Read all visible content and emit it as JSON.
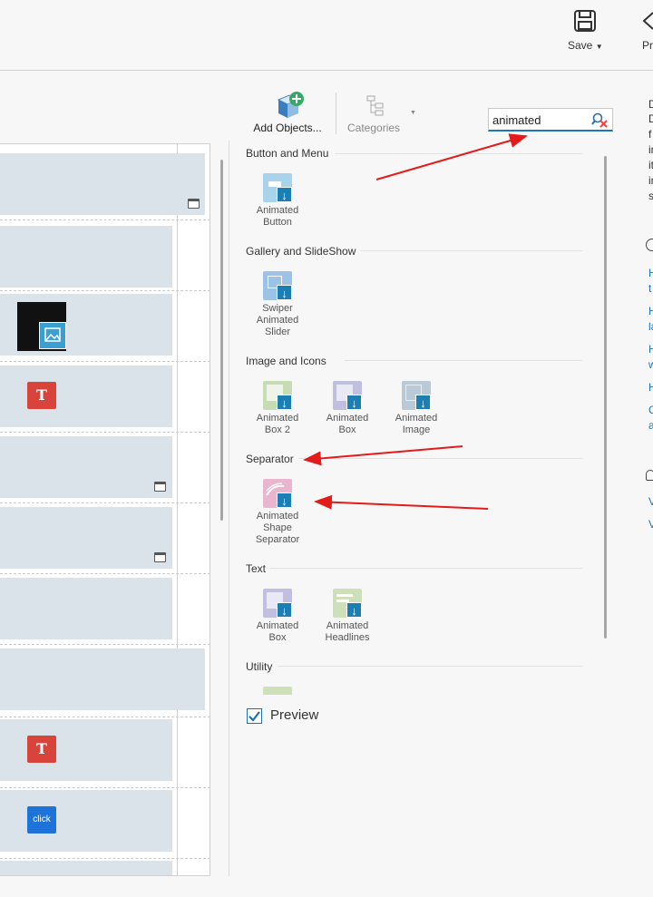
{
  "toolbar": {
    "save_label": "Save",
    "preview_label": "Pr"
  },
  "objects_toolbar": {
    "add_objects_label": "Add Objects...",
    "categories_label": "Categories"
  },
  "search": {
    "value": "animated"
  },
  "categories": [
    {
      "title": "Button and Menu",
      "items": [
        {
          "label": "Animated\nButton",
          "icon": "animated-button-icon",
          "color": "#a9d3ea"
        }
      ]
    },
    {
      "title": "Gallery and SlideShow",
      "items": [
        {
          "label": "Swiper\nAnimated\nSlider",
          "icon": "swiper-slider-icon",
          "color": "#9cc3e6"
        }
      ]
    },
    {
      "title": "Image and Icons",
      "items": [
        {
          "label": "Animated\nBox 2",
          "icon": "animated-box-2-icon",
          "color": "#c7dcb5"
        },
        {
          "label": "Animated\nBox",
          "icon": "animated-box-icon",
          "color": "#c0bfe0"
        },
        {
          "label": "Animated\nImage",
          "icon": "animated-image-icon",
          "color": "#b9c9d6"
        }
      ]
    },
    {
      "title": "Separator",
      "items": [
        {
          "label": "Animated\nShape\nSeparator",
          "icon": "shape-separator-icon",
          "color": "#e8b7cf"
        }
      ]
    },
    {
      "title": "Text",
      "items": [
        {
          "label": "Animated\nBox",
          "icon": "text-animated-box-icon",
          "color": "#c0bfe0"
        },
        {
          "label": "Animated\nHeadlines",
          "icon": "animated-headlines-icon",
          "color": "#cde0b9"
        }
      ]
    },
    {
      "title": "Utility",
      "items": []
    }
  ],
  "preview_checkbox": {
    "label": "Preview",
    "checked": true
  },
  "right_panel": {
    "text_lines": [
      "D",
      "D",
      "f",
      "in",
      "it",
      "in",
      "s"
    ],
    "links": [
      "H",
      "t",
      "H",
      "la",
      "H",
      "w",
      "H",
      "C",
      "a"
    ],
    "links2": [
      "V",
      "V"
    ]
  },
  "left_panel": {
    "badges": {
      "text_icon": "T",
      "click_icon": "click"
    }
  },
  "colors": {
    "accent": "#1f76b5",
    "arrow": "#e31b1b",
    "download": "#1b7fb3"
  }
}
